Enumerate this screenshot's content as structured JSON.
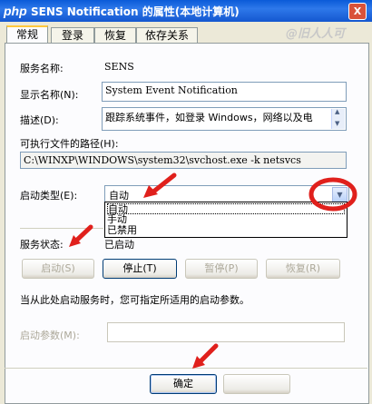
{
  "window": {
    "title": "SENS Notification 的属性(本地计算机)",
    "logo_text": "php",
    "watermark": "@旧人人可",
    "close_glyph": "X"
  },
  "tabs": [
    {
      "label": "常规",
      "active": true
    },
    {
      "label": "登录"
    },
    {
      "label": "恢复"
    },
    {
      "label": "依存关系"
    }
  ],
  "general": {
    "service_name_label": "服务名称:",
    "service_name_value": "SENS",
    "display_name_label": "显示名称(N):",
    "display_name_value": "System Event Notification",
    "description_label": "描述(D):",
    "description_value": "跟踪系统事件，如登录 Windows，网络以及电",
    "exe_path_label": "可执行文件的路径(H):",
    "exe_path_value": "C:\\WINXP\\WINDOWS\\system32\\svchost.exe -k netsvcs",
    "startup_type_label": "启动类型(E):",
    "startup_type_value": "自动",
    "startup_options": [
      "自动",
      "手动",
      "已禁用"
    ],
    "service_status_label": "服务状态:",
    "service_status_value": "已启动",
    "buttons": {
      "start": "启动(S)",
      "stop": "停止(T)",
      "pause": "暂停(P)",
      "resume": "恢复(R)"
    },
    "hint_text": "当从此处启动服务时，您可指定所适用的启动参数。",
    "start_params_label": "启动参数(M):",
    "start_params_value": ""
  },
  "footer": {
    "ok": "确定"
  },
  "annotation_color": "#e0201c"
}
